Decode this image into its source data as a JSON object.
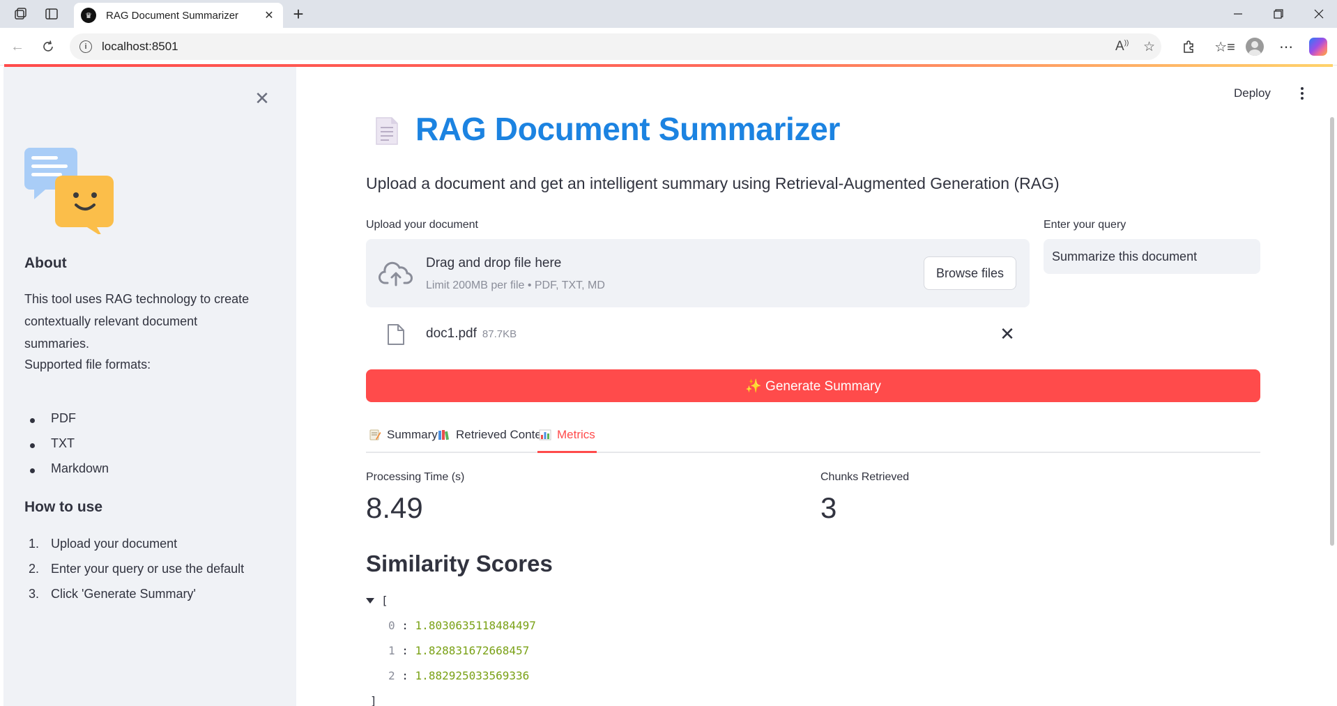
{
  "browser": {
    "tab_title": "RAG Document Summarizer",
    "url": "localhost:8501"
  },
  "sidebar": {
    "about_heading": "About",
    "about_text": "This tool uses RAG technology to create contextually relevant document summaries.",
    "formats_label": "Supported file formats:",
    "formats": [
      "PDF",
      "TXT",
      "Markdown"
    ],
    "howto_heading": "How to use",
    "steps": [
      {
        "num": "1.",
        "text": "Upload your document"
      },
      {
        "num": "2.",
        "text": "Enter your query or use the default"
      },
      {
        "num": "3.",
        "text": "Click 'Generate Summary'"
      }
    ]
  },
  "header": {
    "deploy_label": "Deploy"
  },
  "main": {
    "title": "RAG Document Summarizer",
    "subtitle": "Upload a document and get an intelligent summary using Retrieval-Augmented Generation (RAG)",
    "upload": {
      "label": "Upload your document",
      "dropzone_text": "Drag and drop file here",
      "limit_text": "Limit 200MB per file • PDF, TXT, MD",
      "browse_label": "Browse files"
    },
    "query": {
      "label": "Enter your query",
      "value": "Summarize this document"
    },
    "file": {
      "name": "doc1.pdf",
      "size": "87.7KB"
    },
    "generate_label": "✨ Generate Summary",
    "tabs": [
      {
        "label": "Summary",
        "active": false
      },
      {
        "label": "Retrieved Context",
        "active": false
      },
      {
        "label": "Metrics",
        "active": true
      }
    ],
    "metrics": [
      {
        "label": "Processing Time (s)",
        "value": "8.49"
      },
      {
        "label": "Chunks Retrieved",
        "value": "3"
      }
    ],
    "similarity": {
      "heading": "Similarity Scores",
      "open_bracket": "[",
      "close_bracket": "]",
      "scores": [
        {
          "index": "0",
          "value": "1.8030635118484497"
        },
        {
          "index": "1",
          "value": "1.828831672668457"
        },
        {
          "index": "2",
          "value": "1.882925033569336"
        }
      ]
    }
  },
  "colors": {
    "accent": "#ff4b4b",
    "title_blue": "#1c83e1",
    "sidebar_bg": "#f0f2f6",
    "json_number": "#7aa116"
  }
}
